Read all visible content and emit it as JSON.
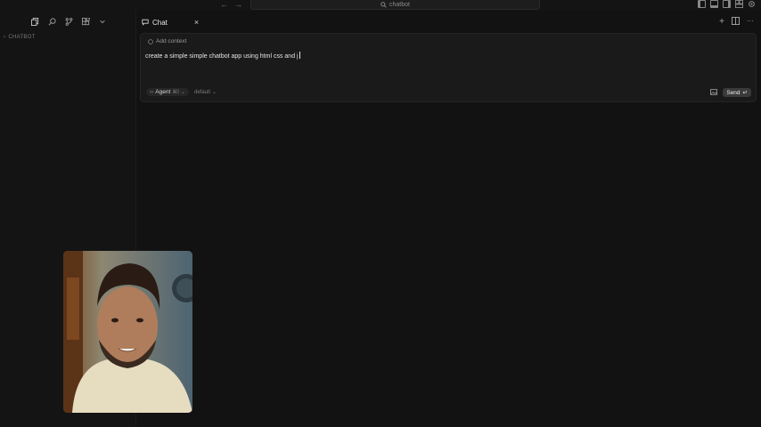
{
  "titlebar": {
    "search_text": "chatbot",
    "back_glyph": "←",
    "forward_glyph": "→"
  },
  "sidebar": {
    "section_label": "CHATBOT",
    "toolbar_icons": [
      "explorer-icon",
      "search-icon",
      "source-control-icon",
      "extensions-icon",
      "chevron-down-icon"
    ]
  },
  "chat_tab": {
    "label": "Chat",
    "close_glyph": "×"
  },
  "tab_actions": {
    "new_glyph": "+",
    "more_glyph": "···"
  },
  "composer": {
    "add_context_label": "Add context",
    "prompt_text": "create a simple simple chatbot app using html css and j",
    "agent_label": "Agent",
    "agent_shortcut": "⌘I",
    "model_label": "default",
    "send_label": "Send",
    "send_shortcut": "↵"
  }
}
